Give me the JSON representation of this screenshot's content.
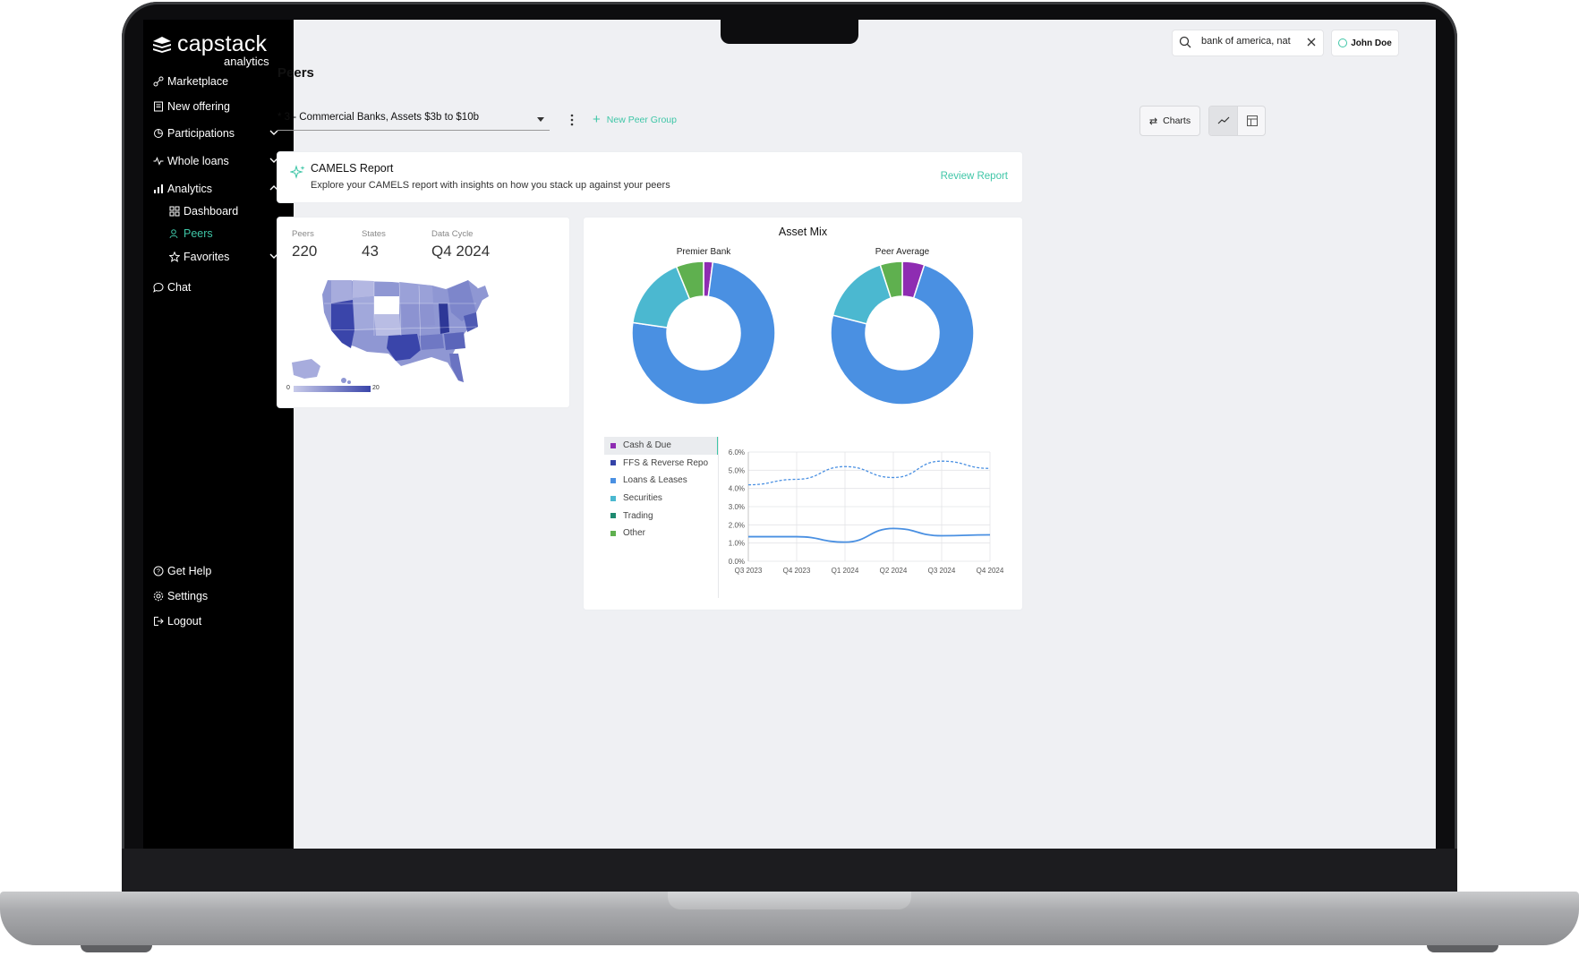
{
  "brand": {
    "name": "capstack",
    "sub": "analytics"
  },
  "sidebar": {
    "items": [
      {
        "label": "Marketplace"
      },
      {
        "label": "New offering"
      },
      {
        "label": "Participations"
      },
      {
        "label": "Whole loans"
      },
      {
        "label": "Analytics"
      },
      {
        "label": "Dashboard"
      },
      {
        "label": "Peers"
      },
      {
        "label": "Favorites"
      },
      {
        "label": "Chat"
      }
    ],
    "footer": [
      {
        "label": "Get Help"
      },
      {
        "label": "Settings"
      },
      {
        "label": "Logout"
      }
    ]
  },
  "search": {
    "value": "bank of america, nat"
  },
  "user": {
    "name": "John Doe"
  },
  "page": {
    "title": "Peers"
  },
  "peer_group": {
    "selected": "* 3 - Commercial Banks, Assets $3b to $10b",
    "new_label": "New Peer Group"
  },
  "view": {
    "charts_label": "Charts"
  },
  "camels": {
    "title": "CAMELS Report",
    "subtitle": "Explore your CAMELS report with insights on how you stack up against your peers",
    "action": "Review Report"
  },
  "stats": [
    {
      "label": "Peers",
      "value": "220"
    },
    {
      "label": "States",
      "value": "43"
    },
    {
      "label": "Data Cycle",
      "value": "Q4 2024"
    }
  ],
  "map_legend": {
    "min": "0",
    "max": "20"
  },
  "colors": {
    "accent": "#3fc6a7",
    "cash_due": "#8e2cb2",
    "ffs": "#3443a8",
    "loans": "#4a90e2",
    "securities": "#4bb8d0",
    "trading": "#1e8a70",
    "other": "#5fb04f"
  },
  "chart_data": [
    {
      "type": "pie",
      "title": "Asset Mix",
      "subtitle": "Premier Bank",
      "categories": [
        "Cash & Due",
        "Loans & Leases",
        "Securities",
        "Other"
      ],
      "values": [
        2,
        73,
        16,
        6
      ]
    },
    {
      "type": "pie",
      "subtitle": "Peer Average",
      "categories": [
        "Cash & Due",
        "Loans & Leases",
        "Securities",
        "Other"
      ],
      "values": [
        5,
        74,
        16,
        5
      ]
    },
    {
      "type": "line",
      "legend": [
        "Cash & Due",
        "FFS & Reverse Repo",
        "Loans & Leases",
        "Securities",
        "Trading",
        "Other"
      ],
      "selected": "Cash & Due",
      "x": [
        "Q3 2023",
        "Q4 2023",
        "Q1 2024",
        "Q2 2024",
        "Q3 2024",
        "Q4 2024"
      ],
      "y_ticks": [
        "6.0%",
        "5.0%",
        "4.0%",
        "3.0%",
        "2.0%",
        "1.0%",
        "0.0%"
      ],
      "ylim": [
        0,
        6
      ],
      "grid": true,
      "series": [
        {
          "style": "dashed",
          "values": [
            4.2,
            4.5,
            5.2,
            4.6,
            5.5,
            5.1
          ]
        },
        {
          "style": "solid",
          "values": [
            1.35,
            1.35,
            1.05,
            1.8,
            1.4,
            1.45
          ]
        }
      ]
    }
  ]
}
